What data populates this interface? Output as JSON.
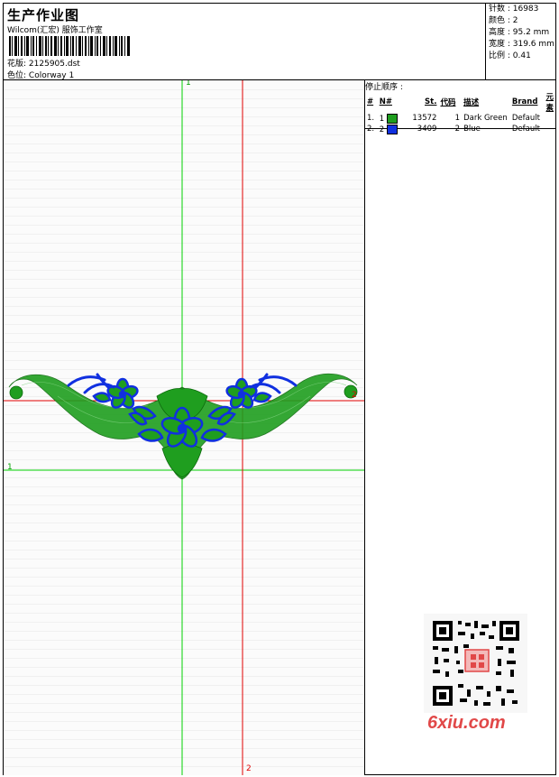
{
  "header": {
    "title": "生产作业图",
    "company": "Wilcom(汇宏) 服饰工作室",
    "design_label": "花版:",
    "design_value": "2125905.dst",
    "colorway_label": "色位:",
    "colorway_value": "Colorway 1"
  },
  "stats": {
    "stitches": "针数 : 16983",
    "colors": "颜色 : 2",
    "height": "高度 : 95.2 mm",
    "width": "宽度 : 319.6 mm",
    "scale": "比例 : 0.41"
  },
  "stop_panel": {
    "title": "停止顺序 :",
    "headers": [
      "#",
      "N#",
      "St.",
      "代码",
      "描述",
      "Brand",
      "元素"
    ],
    "rows": [
      {
        "index": "1.",
        "n": "1",
        "stitches": "13572",
        "code": "1",
        "desc": "Dark Green",
        "brand": "Default",
        "color": "#1f9e1f"
      },
      {
        "index": "2.",
        "n": "2",
        "stitches": "3409",
        "code": "2",
        "desc": "Blue",
        "brand": "Default",
        "color": "#1030e0"
      }
    ]
  },
  "axes": {
    "green_top_label": "1",
    "green_left_label": "1",
    "red_right_label": "2",
    "red_bottom_label": "2"
  },
  "colors": {
    "green_thread": "#1f9e1f",
    "blue_thread": "#1030e0",
    "axis_green": "#00d000",
    "axis_red": "#e00000"
  },
  "watermark": "6xiu.com"
}
